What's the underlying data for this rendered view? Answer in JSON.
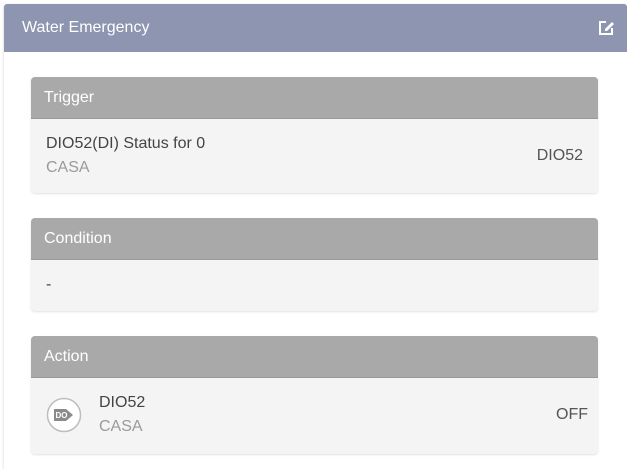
{
  "header": {
    "title": "Water Emergency",
    "edit_icon": "edit-icon",
    "background": "#8d95b0"
  },
  "trigger": {
    "label": "Trigger",
    "item": {
      "title": "DIO52(DI) Status for 0",
      "subtitle": "CASA",
      "value": "DIO52"
    }
  },
  "condition": {
    "label": "Condition",
    "value": "-"
  },
  "action": {
    "label": "Action",
    "item": {
      "icon": "do-output-icon",
      "icon_text": "DO",
      "title": "DIO52",
      "subtitle": "CASA",
      "value": "OFF"
    }
  }
}
